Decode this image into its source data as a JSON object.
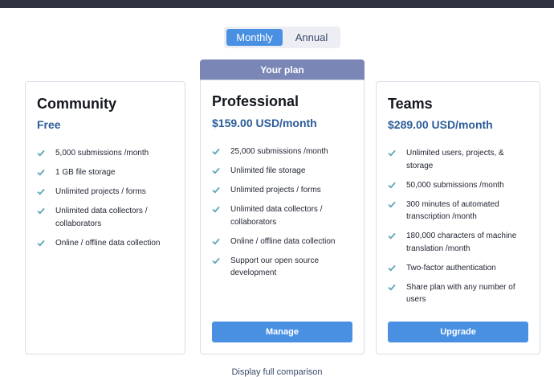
{
  "billing_toggle": {
    "monthly": "Monthly",
    "annual": "Annual"
  },
  "current_plan_banner": "Your plan",
  "plans": [
    {
      "name": "Community",
      "price": "Free",
      "features": [
        "5,000 submissions /month",
        "1 GB file storage",
        "Unlimited projects / forms",
        "Unlimited data collectors / collaborators",
        "Online / offline data collection"
      ]
    },
    {
      "name": "Professional",
      "price": "$159.00 USD/month",
      "features": [
        "25,000 submissions /month",
        "Unlimited file storage",
        "Unlimited projects / forms",
        "Unlimited data collectors / collaborators",
        "Online / offline data collection",
        "Support our open source development"
      ],
      "button": "Manage"
    },
    {
      "name": "Teams",
      "price": "$289.00 USD/month",
      "features": [
        "Unlimited users, projects, & storage",
        "50,000 submissions /month",
        "300 minutes of automated transcription /month",
        "180,000 characters of machine translation /month",
        "Two-factor authentication",
        "Share plan with any number of users"
      ],
      "button": "Upgrade"
    }
  ],
  "colors": {
    "accent": "#4a90e2",
    "banner": "#7a87b6",
    "price": "#2c5d9a",
    "check": "#5aa6b8"
  },
  "footer_link": "Display full comparison"
}
